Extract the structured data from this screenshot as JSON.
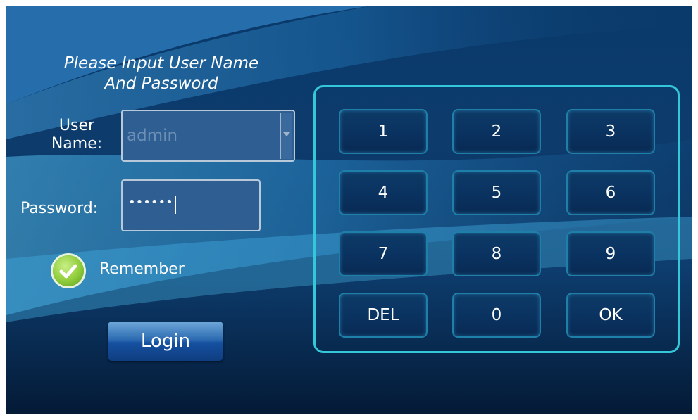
{
  "login": {
    "title_line1": "Please Input User Name",
    "title_line2": "And Password",
    "user_label_line1": "User",
    "user_label_line2": "Name:",
    "username_value": "admin",
    "password_label": "Password:",
    "password_value": "••••••",
    "remember_label": "Remember",
    "remember_checked": true,
    "login_button": "Login"
  },
  "keypad": {
    "keys": [
      "1",
      "2",
      "3",
      "4",
      "5",
      "6",
      "7",
      "8",
      "9",
      "DEL",
      "0",
      "OK"
    ]
  },
  "colors": {
    "keypad_border": "#34c7d9",
    "checkbox_green": "#8fcc3a",
    "login_button_blue": "#1550a0"
  }
}
